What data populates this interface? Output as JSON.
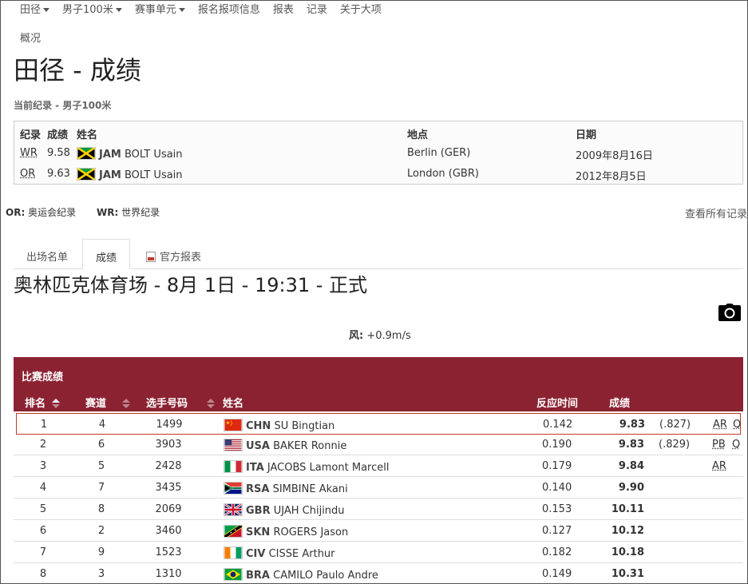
{
  "nav": {
    "items": [
      {
        "label": "田径",
        "caret": true
      },
      {
        "label": "男子100米",
        "caret": true
      },
      {
        "label": "赛事单元",
        "caret": true
      },
      {
        "label": "报名报项信息",
        "caret": false
      },
      {
        "label": "报表",
        "caret": false
      },
      {
        "label": "记录",
        "caret": false
      },
      {
        "label": "关于大项",
        "caret": false
      }
    ]
  },
  "breadcrumb": "概况",
  "page_title": "田径 - 成绩",
  "records": {
    "caption": "当前纪录 - 男子100米",
    "headers": {
      "record": "纪录",
      "result": "成绩",
      "name": "姓名",
      "venue": "地点",
      "date": "日期"
    },
    "rows": [
      {
        "record": "WR",
        "result": "9.58",
        "noc": "JAM",
        "athlete": "BOLT Usain",
        "venue": "Berlin (GER)",
        "date": "2009年8月16日",
        "flag": "jam"
      },
      {
        "record": "OR",
        "result": "9.63",
        "noc": "JAM",
        "athlete": "BOLT Usain",
        "venue": "London (GBR)",
        "date": "2012年8月5日",
        "flag": "jam"
      }
    ],
    "legend": [
      {
        "abbr": "OR:",
        "text": " 奥运会纪录"
      },
      {
        "abbr": "WR:",
        "text": " 世界纪录"
      }
    ],
    "see_all": "查看所有记录"
  },
  "tabs": [
    {
      "label": "出场名单",
      "active": false
    },
    {
      "label": "成绩",
      "active": true
    },
    {
      "label": "官方报表",
      "active": false,
      "icon": "pdf-icon"
    }
  ],
  "session_title": "奥林匹克体育场 - 8月 1日 - 19:31 - 正式",
  "wind": {
    "label": "风:",
    "value": " +0.9m/s"
  },
  "results": {
    "caption": "比赛成绩",
    "headers": {
      "rank": "排名",
      "lane": "赛道",
      "bib": "选手号码",
      "name": "姓名",
      "reaction": "反应时间",
      "result": "成绩"
    },
    "rows": [
      {
        "rank": "1",
        "lane": "4",
        "bib": "1499",
        "noc": "CHN",
        "athlete": "SU Bingtian",
        "reaction": "0.142",
        "result": "9.83",
        "dist": "(.827)",
        "record": "AR",
        "qual": "Q",
        "flag": "chn",
        "highlight": true
      },
      {
        "rank": "2",
        "lane": "6",
        "bib": "3903",
        "noc": "USA",
        "athlete": "BAKER Ronnie",
        "reaction": "0.190",
        "result": "9.83",
        "dist": "(.829)",
        "record": "PB",
        "qual": "Q",
        "flag": "usa"
      },
      {
        "rank": "3",
        "lane": "5",
        "bib": "2428",
        "noc": "ITA",
        "athlete": "JACOBS Lamont Marcell",
        "reaction": "0.179",
        "result": "9.84",
        "dist": "",
        "record": "AR",
        "qual": "",
        "flag": "ita"
      },
      {
        "rank": "4",
        "lane": "7",
        "bib": "3435",
        "noc": "RSA",
        "athlete": "SIMBINE Akani",
        "reaction": "0.140",
        "result": "9.90",
        "dist": "",
        "record": "",
        "qual": "",
        "flag": "rsa"
      },
      {
        "rank": "5",
        "lane": "8",
        "bib": "2069",
        "noc": "GBR",
        "athlete": "UJAH Chijindu",
        "reaction": "0.153",
        "result": "10.11",
        "dist": "",
        "record": "",
        "qual": "",
        "flag": "gbr"
      },
      {
        "rank": "6",
        "lane": "2",
        "bib": "3460",
        "noc": "SKN",
        "athlete": "ROGERS Jason",
        "reaction": "0.127",
        "result": "10.12",
        "dist": "",
        "record": "",
        "qual": "",
        "flag": "skn"
      },
      {
        "rank": "7",
        "lane": "9",
        "bib": "1523",
        "noc": "CIV",
        "athlete": "CISSE Arthur",
        "reaction": "0.182",
        "result": "10.18",
        "dist": "",
        "record": "",
        "qual": "",
        "flag": "civ"
      },
      {
        "rank": "8",
        "lane": "3",
        "bib": "1310",
        "noc": "BRA",
        "athlete": "CAMILO Paulo Andre",
        "reaction": "0.149",
        "result": "10.31",
        "dist": "",
        "record": "",
        "qual": "",
        "flag": "bra"
      }
    ]
  },
  "colors": {
    "panel_header": "#8b2232",
    "highlight_border": "#c0392b"
  }
}
